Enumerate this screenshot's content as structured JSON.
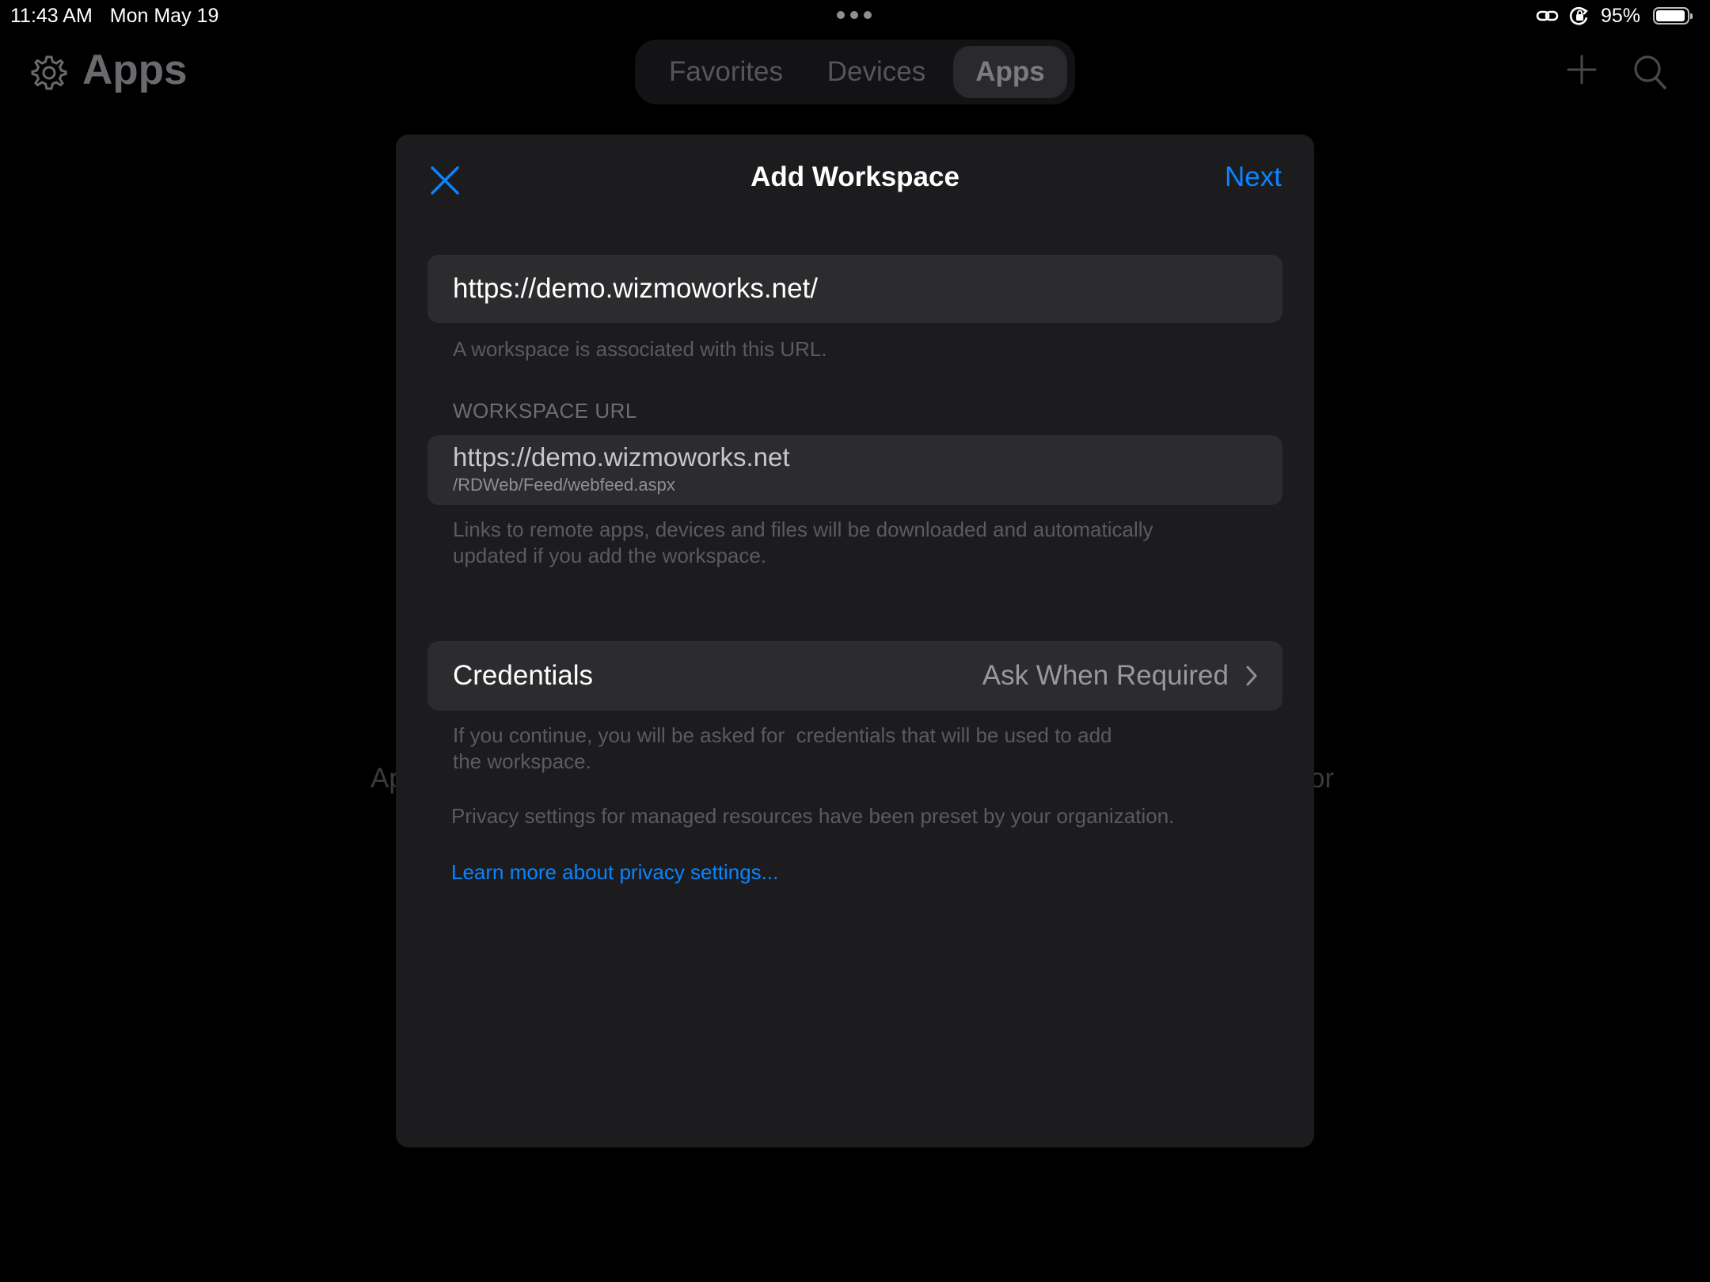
{
  "status_bar": {
    "time": "11:43 AM",
    "date": "Mon May 19",
    "battery_percent": "95%",
    "battery_level": 0.95,
    "icons": [
      "link-icon",
      "orientation-lock-icon",
      "battery-icon"
    ]
  },
  "header": {
    "title": "Apps",
    "settings_icon": "gear-icon",
    "tabs": [
      {
        "label": "Favorites",
        "active": false
      },
      {
        "label": "Devices",
        "active": false
      },
      {
        "label": "Apps",
        "active": true
      }
    ],
    "add_icon": "plus-icon",
    "search_icon": "search-icon"
  },
  "background_text": {
    "left_fragment": "Ap",
    "right_fragment": "or"
  },
  "modal": {
    "title": "Add Workspace",
    "close_icon": "close-icon",
    "next_label": "Next",
    "url_input_value": "https://demo.wizmoworks.net/",
    "url_hint": "A workspace is associated with this URL.",
    "workspace_url_label": "WORKSPACE URL",
    "workspace_url_main": "https://demo.wizmoworks.net",
    "workspace_url_path": "/RDWeb/Feed/webfeed.aspx",
    "workspace_hint_line1": "Links to remote apps, devices and files will be downloaded and automatically",
    "workspace_hint_line2": "updated if you add the workspace.",
    "credentials_label": "Credentials",
    "credentials_value": "Ask When Required",
    "credentials_hint_line1": "If you continue, you will be asked for  credentials that will be used to add",
    "credentials_hint_line2": "the workspace.",
    "privacy_note": "Privacy settings for managed resources have been preset by your organization.",
    "privacy_link": "Learn more about privacy settings..."
  },
  "colors": {
    "accent": "#0a84ff",
    "modal_background": "#1c1c1e",
    "field_background": "#2c2c2e",
    "screen_background": "#000000"
  }
}
